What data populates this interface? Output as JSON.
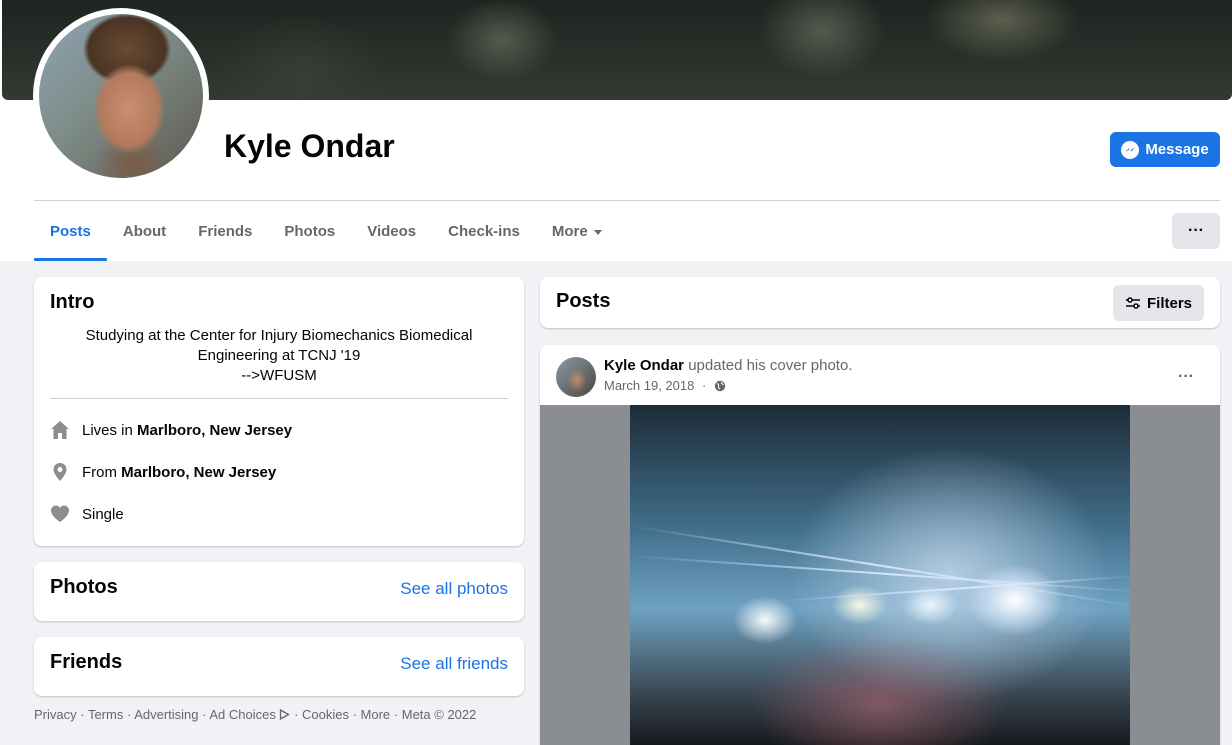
{
  "profile": {
    "name": "Kyle Ondar",
    "message_label": "Message"
  },
  "tabs": [
    {
      "label": "Posts",
      "active": true
    },
    {
      "label": "About"
    },
    {
      "label": "Friends"
    },
    {
      "label": "Photos"
    },
    {
      "label": "Videos"
    },
    {
      "label": "Check-ins"
    },
    {
      "label": "More"
    }
  ],
  "more_options_label": "···",
  "intro": {
    "title": "Intro",
    "bio_lines": [
      "Studying at the Center for Injury Biomechanics Biomedical",
      "Engineering at TCNJ '19",
      "-->WFUSM"
    ],
    "lives_prefix": "Lives in ",
    "lives_place": "Marlboro, New Jersey",
    "from_prefix": "From ",
    "from_place": "Marlboro, New Jersey",
    "relationship": "Single"
  },
  "photos_card": {
    "title": "Photos",
    "link": "See all photos"
  },
  "friends_card": {
    "title": "Friends",
    "link": "See all friends"
  },
  "footer": {
    "links": [
      "Privacy",
      "Terms",
      "Advertising",
      "Ad Choices",
      "Cookies",
      "More"
    ],
    "separator": " · ",
    "copyright": "Meta © 2022"
  },
  "posts_header": {
    "title": "Posts",
    "filters_label": "Filters"
  },
  "post": {
    "author": "Kyle Ondar",
    "action": " updated his cover photo.",
    "date": "March 19, 2018",
    "date_sep": " · ",
    "menu_label": "···"
  },
  "colors": {
    "accent": "#1b74e4",
    "background": "#f0f2f5",
    "secondary_text": "#65676b"
  },
  "icons": [
    "messenger-icon",
    "home-icon",
    "location-pin-icon",
    "heart-icon",
    "filters-icon",
    "globe-icon",
    "caret-down-icon",
    "ad-choices-icon"
  ]
}
